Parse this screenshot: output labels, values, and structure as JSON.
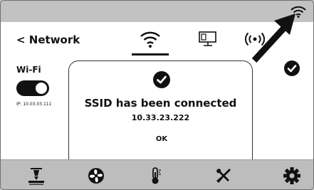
{
  "header": {
    "back_label": "< Network"
  },
  "tabs": [
    {
      "name": "wifi",
      "label": ""
    },
    {
      "name": "ethernet",
      "label": ""
    },
    {
      "name": "hotspot",
      "label": ""
    }
  ],
  "wifi": {
    "label": "Wi-Fi",
    "enabled": true,
    "ip_label": "IP: 10.03.03.111"
  },
  "dialog": {
    "message": "SSID has been connected",
    "ip": "10.33.23.222",
    "ok_label": "OK"
  },
  "bottom_nav": [
    {
      "icon": "print-head-icon"
    },
    {
      "icon": "fan-icon"
    },
    {
      "icon": "thermometer-icon"
    },
    {
      "icon": "tools-icon"
    },
    {
      "icon": "settings-gear-icon"
    }
  ],
  "colors": {
    "statusbar": "#c2c2c2",
    "bottombar": "#bdbdbd",
    "dark": "#111111",
    "background": "#ffffff"
  }
}
